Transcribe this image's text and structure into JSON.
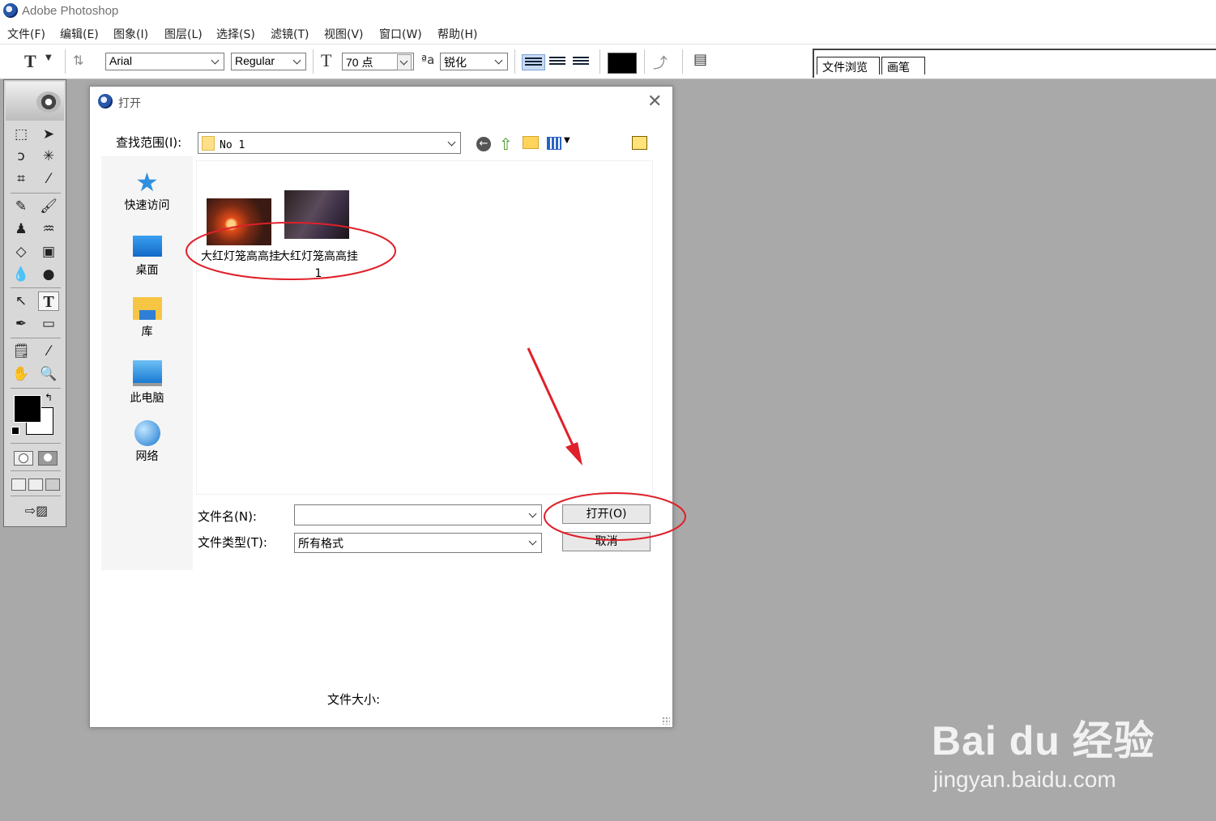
{
  "app": {
    "title": "Adobe Photoshop"
  },
  "menu": [
    "文件(F)",
    "编辑(E)",
    "图象(I)",
    "图层(L)",
    "选择(S)",
    "滤镜(T)",
    "视图(V)",
    "窗口(W)",
    "帮助(H)"
  ],
  "options": {
    "tool_glyph": "T",
    "font_family": "Arial",
    "font_style": "Regular",
    "size_icon": "T",
    "font_size": "70 点",
    "aa_icon": "ªa",
    "antialias": "锐化",
    "text_color": "#000000"
  },
  "palette_tabs": [
    "文件浏览",
    "画笔"
  ],
  "dialog": {
    "title": "打开",
    "look_in_label": "查找范围(I):",
    "look_in_value": "No 1",
    "places": [
      "快速访问",
      "桌面",
      "库",
      "此电脑",
      "网络"
    ],
    "files": [
      {
        "name": "大红灯笼高高挂"
      },
      {
        "name": "大红灯笼高高挂1"
      }
    ],
    "filename_label": "文件名(N):",
    "filename_value": "",
    "filetype_label": "文件类型(T):",
    "filetype_value": "所有格式",
    "open_button": "打开(O)",
    "cancel_button": "取消",
    "filesize_label": "文件大小:"
  },
  "annotation_color": "#e0202a",
  "watermark": {
    "brand": "Bai du 经验",
    "url": "jingyan.baidu.com"
  }
}
